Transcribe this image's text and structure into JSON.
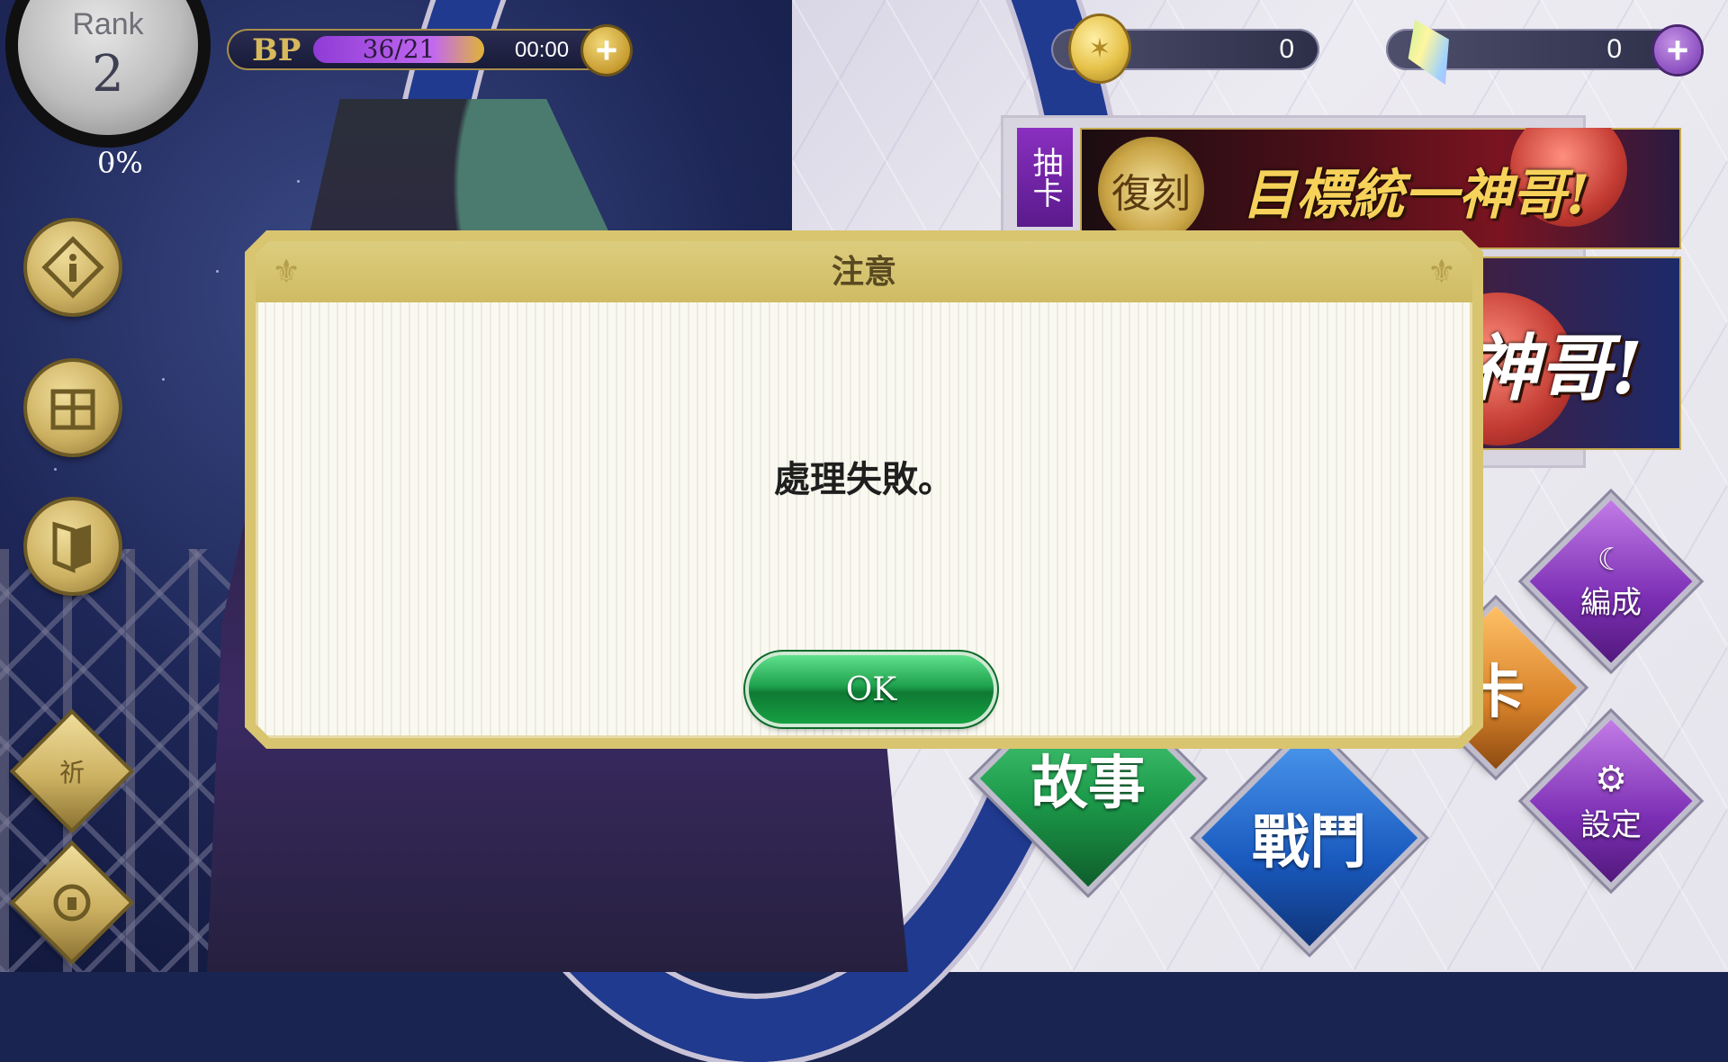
{
  "player": {
    "rank_label": "Rank",
    "rank_value": "2",
    "rank_percent": "0%"
  },
  "bp": {
    "label": "BP",
    "count": "36/21",
    "timer": "00:00",
    "fill_fraction": 1.0
  },
  "currency": {
    "coins": "0",
    "gems": "0"
  },
  "sidebar": {
    "pray_label": "祈"
  },
  "banners": {
    "tab_label": "抽卡",
    "banner1_seal": "復刻",
    "banner1_text": "目標統一神哥!",
    "banner2_text": "神哥!"
  },
  "menu": {
    "formation": "編成",
    "gacha": "卡",
    "story": "故事",
    "battle": "戰鬥",
    "settings": "設定"
  },
  "dialog": {
    "title": "注意",
    "message": "處理失敗。",
    "ok_label": "OK"
  },
  "colors": {
    "dialog_frame": "#d9c570",
    "dialog_body": "#faf9f1",
    "ok_green": "#1fa24d",
    "bp_fill": "#c268f0"
  }
}
